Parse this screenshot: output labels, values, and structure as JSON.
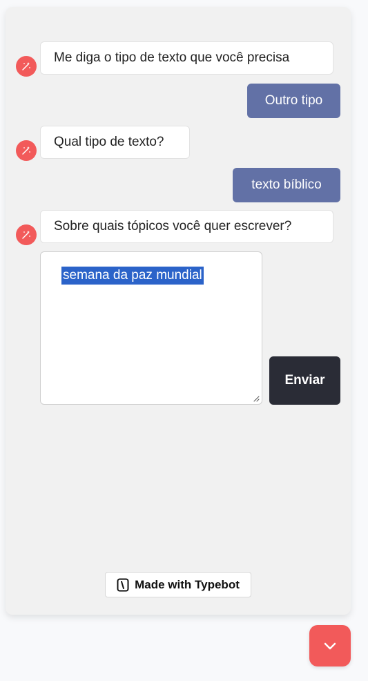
{
  "chat": {
    "messages": [
      {
        "role": "bot",
        "text": "Me diga o tipo de texto que você precisa"
      },
      {
        "role": "user",
        "text": "Outro tipo"
      },
      {
        "role": "bot",
        "text": "Qual tipo de texto?"
      },
      {
        "role": "user",
        "text": "texto bíblico"
      },
      {
        "role": "bot",
        "text": "Sobre quais tópicos você quer escrever?"
      }
    ],
    "input": {
      "value": "semana da paz mundial"
    },
    "send_label": "Enviar"
  },
  "footer": {
    "badge_label": "Made with Typebot"
  },
  "colors": {
    "accent": "#f25a5a",
    "user_bubble": "#6271a6",
    "send_button": "#2a2c36",
    "panel_bg": "#f1f1f1",
    "selection": "#2b63c9"
  },
  "icons": {
    "bot_avatar": "magic-wand-icon",
    "badge": "typebot-logo-icon",
    "launcher": "chevron-down-icon",
    "resize": "resize-handle-icon"
  }
}
